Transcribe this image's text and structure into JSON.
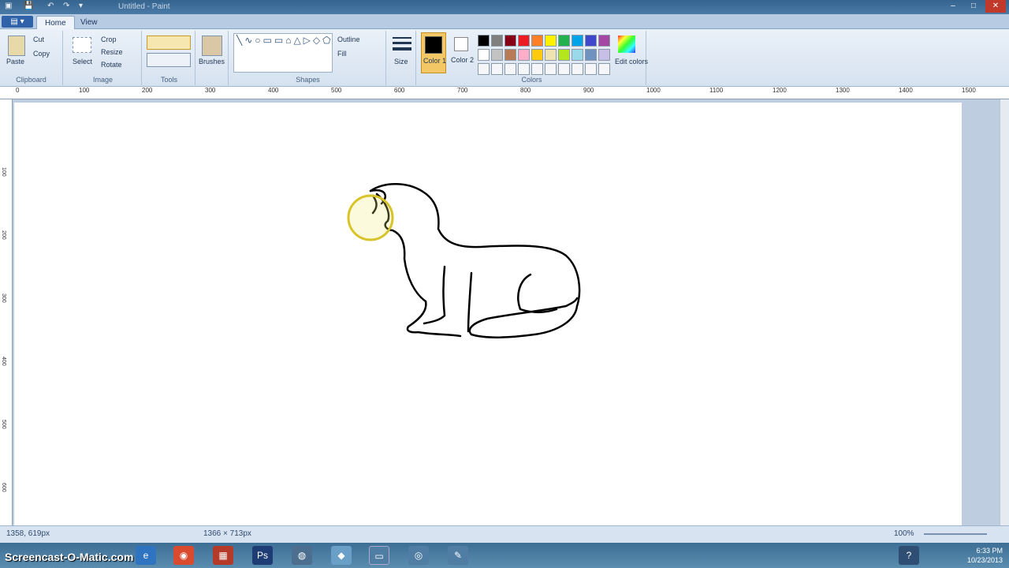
{
  "window": {
    "title": "Untitled - Paint",
    "quick_access": [
      "▣",
      "💾",
      "↶",
      "↷",
      "▾"
    ],
    "controls": [
      "–",
      "□",
      "✕"
    ]
  },
  "tabs": {
    "file": "▤ ▾",
    "items": [
      "Home",
      "View"
    ]
  },
  "ribbon": {
    "clipboard": {
      "label": "Clipboard",
      "paste": "Paste",
      "cut": "Cut",
      "copy": "Copy"
    },
    "image": {
      "label": "Image",
      "select": "Select",
      "crop": "Crop",
      "resize": "Resize",
      "rotate": "Rotate"
    },
    "tools": {
      "label": "Tools",
      "brushes": "Brushes"
    },
    "shapes": {
      "label": "Shapes",
      "outline": "Outline",
      "fill": "Fill",
      "glyphs": "╲∿○▭▭⌂△▷◇⬠⬡⇨⇦⇧⇩☆✦✧▭▭○♡⚡"
    },
    "size": {
      "label": "Size"
    },
    "colors": {
      "label": "Colors",
      "color1": "Color 1",
      "color2": "Color 2",
      "edit": "Edit colors",
      "palette_row1": [
        "#000000",
        "#7f7f7f",
        "#880015",
        "#ed1c24",
        "#ff7f27",
        "#fff200",
        "#22b14c",
        "#00a2e8",
        "#3f48cc",
        "#a349a4"
      ],
      "palette_row2": [
        "#ffffff",
        "#c3c3c3",
        "#b97a57",
        "#ffaec9",
        "#ffc90e",
        "#efe4b0",
        "#b5e61d",
        "#99d9ea",
        "#7092be",
        "#c8bfe7"
      ],
      "color1_value": "#000000",
      "color2_value": "#ffffff"
    }
  },
  "rulers": {
    "h": [
      "0",
      "100",
      "200",
      "300",
      "400",
      "500",
      "600",
      "700",
      "800",
      "900",
      "1000",
      "1100",
      "1200",
      "1300",
      "1400",
      "1500"
    ],
    "v": [
      "100",
      "200",
      "300",
      "400",
      "500",
      "600"
    ]
  },
  "statusbar": {
    "position": "1358, 619px",
    "selection": "1366 × 713px",
    "zoom": "100%"
  },
  "taskbar": {
    "watermark": "Screencast-O-Matic.com",
    "time": "6:33 PM",
    "date": "10/23/2013"
  }
}
